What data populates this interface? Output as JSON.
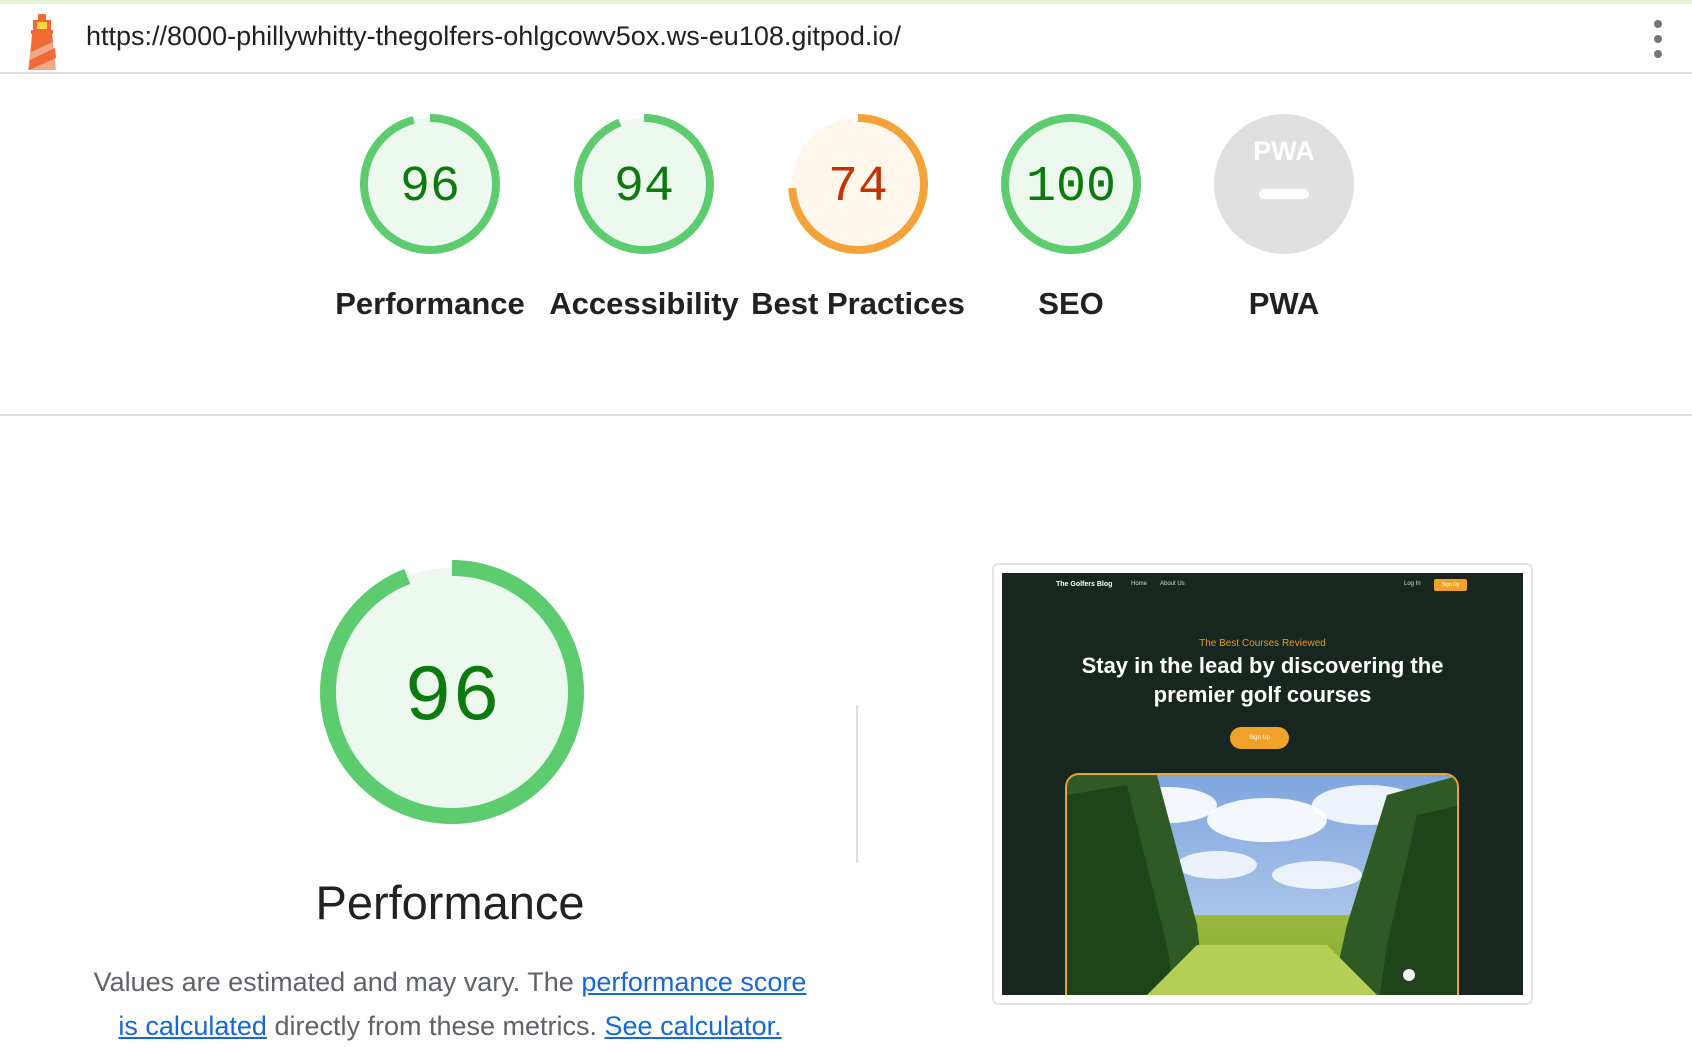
{
  "header": {
    "url": "https://8000-phillywhitty-thegolfers-ohlgcowv5ox.ws-eu108.gitpod.io/",
    "logo_icon": "lighthouse-icon",
    "menu_icon": "more-vert-icon"
  },
  "colors": {
    "pass": "#0c7a0c",
    "pass_ring": "#5ccc6e",
    "pass_fill": "#edf8ef",
    "average": "#c33300",
    "average_ring": "#f4a33a",
    "average_fill": "#fff6ec",
    "na_fill": "#e0e0e0",
    "link": "#1967d2"
  },
  "categories": [
    {
      "label": "Performance",
      "score": "96"
    },
    {
      "label": "Accessibility",
      "score": "94"
    },
    {
      "label": "Best Practices",
      "score": "74"
    },
    {
      "label": "SEO",
      "score": "100"
    },
    {
      "label": "PWA",
      "score": ""
    }
  ],
  "pwa_badge": "PWA",
  "performance": {
    "score": "96",
    "title": "Performance",
    "desc_intro": "Values are estimated and may vary. The ",
    "desc_link1": "performance score is calculated",
    "desc_mid": " directly from these metrics. ",
    "desc_link2": "See calculator."
  },
  "screenshot": {
    "brand": "The Golfers Blog",
    "nav_home": "Home",
    "nav_about": "About Us",
    "login": "Log In",
    "signup": "Sign Up",
    "kicker": "The Best Courses Reviewed",
    "headline": "Stay in the lead by discovering the premier golf courses",
    "cta": "Sign Up"
  }
}
